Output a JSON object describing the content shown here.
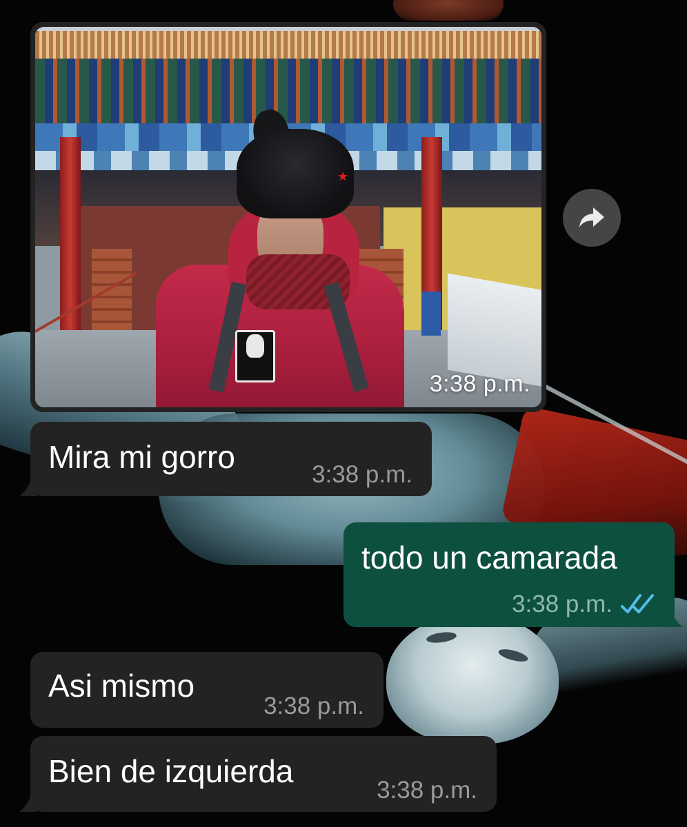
{
  "photo_message": {
    "time": "3:38 p.m."
  },
  "messages": [
    {
      "direction": "incoming",
      "text": "Mira mi gorro",
      "time": "3:38 p.m."
    },
    {
      "direction": "outgoing",
      "text": "todo un camarada",
      "time": "3:38 p.m.",
      "status_icon": "double-check-read-icon"
    },
    {
      "direction": "incoming",
      "text": "Asi mismo",
      "time": "3:38 p.m."
    },
    {
      "direction": "incoming",
      "text": "Bien de izquierda",
      "time": "3:38 p.m."
    }
  ],
  "icons": {
    "forward": "forward-arrow-icon",
    "read_receipt": "double-check-read-icon"
  },
  "colors": {
    "incoming_bubble": "#232323",
    "outgoing_bubble": "#0e5040",
    "read_check": "#53bdeb",
    "background": "#050505"
  }
}
